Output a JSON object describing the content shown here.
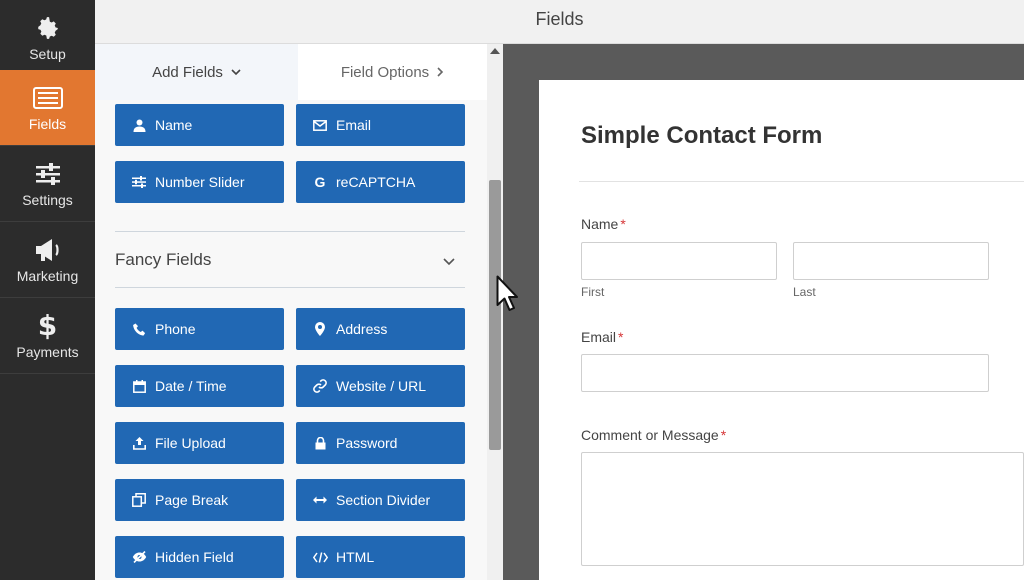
{
  "topbar": {
    "title": "Fields"
  },
  "sidebar": {
    "items": [
      {
        "label": "Setup",
        "icon": "gear-icon"
      },
      {
        "label": "Fields",
        "icon": "fields-list-icon",
        "active": true
      },
      {
        "label": "Settings",
        "icon": "sliders-icon"
      },
      {
        "label": "Marketing",
        "icon": "megaphone-icon"
      },
      {
        "label": "Payments",
        "icon": "dollar-icon"
      }
    ]
  },
  "panel": {
    "tabs": {
      "add_fields": "Add Fields",
      "field_options": "Field Options"
    },
    "standard_fields": [
      {
        "label": "Name",
        "icon": "user-icon"
      },
      {
        "label": "Email",
        "icon": "envelope-icon"
      },
      {
        "label": "Number Slider",
        "icon": "sliders-icon"
      },
      {
        "label": "reCAPTCHA",
        "icon": "google-g-icon"
      }
    ],
    "fancy_section": {
      "title": "Fancy Fields"
    },
    "fancy_fields": [
      {
        "label": "Phone",
        "icon": "phone-icon"
      },
      {
        "label": "Address",
        "icon": "map-pin-icon"
      },
      {
        "label": "Date / Time",
        "icon": "calendar-icon"
      },
      {
        "label": "Website / URL",
        "icon": "link-icon"
      },
      {
        "label": "File Upload",
        "icon": "upload-icon"
      },
      {
        "label": "Password",
        "icon": "lock-icon"
      },
      {
        "label": "Page Break",
        "icon": "copy-icon"
      },
      {
        "label": "Section Divider",
        "icon": "arrows-horizontal-icon"
      },
      {
        "label": "Hidden Field",
        "icon": "eye-slash-icon"
      },
      {
        "label": "HTML",
        "icon": "code-icon"
      }
    ]
  },
  "form": {
    "title": "Simple Contact Form",
    "name_label": "Name",
    "required_mark": "*",
    "first_sublabel": "First",
    "last_sublabel": "Last",
    "email_label": "Email",
    "message_label": "Comment or Message"
  },
  "colors": {
    "accent_orange": "#e27730",
    "button_blue": "#2168b4",
    "sidebar_dark": "#2c2c2c",
    "required_red": "#d63638"
  }
}
